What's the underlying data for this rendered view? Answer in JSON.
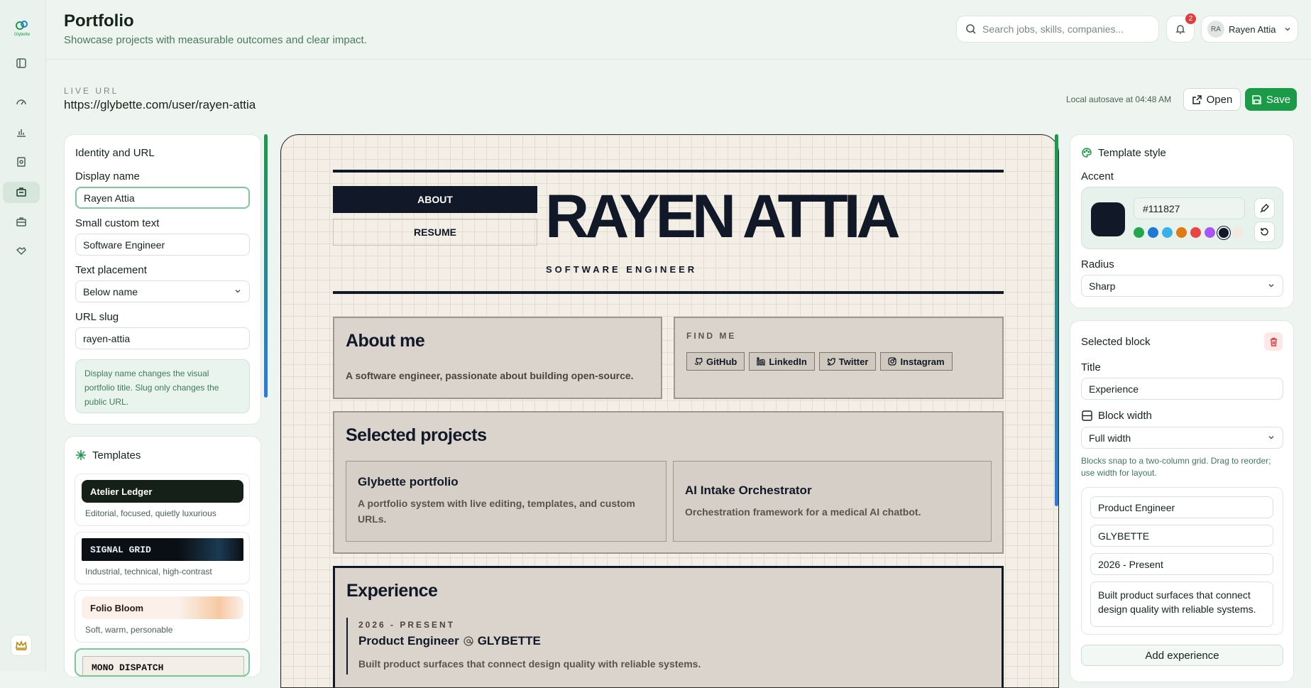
{
  "header": {
    "title": "Portfolio",
    "subtitle": "Showcase projects with measurable outcomes and clear impact.",
    "search_placeholder": "Search jobs, skills, companies...",
    "notification_count": "2",
    "user_initials": "RA",
    "user_name": "Rayen Attia"
  },
  "rail": {
    "logo_text": "Glybette",
    "icons": [
      "sidebar-toggle-icon",
      "speedometer-icon",
      "bar-chart-icon",
      "document-icon",
      "portfolio-icon",
      "briefcase-icon",
      "handshake-icon",
      "crown-icon"
    ]
  },
  "toolbar": {
    "live_url_label": "LIVE URL",
    "live_url": "https://glybette.com/user/rayen-attia",
    "autosave": "Local autosave at 04:48 AM",
    "open_label": "Open",
    "save_label": "Save"
  },
  "identity": {
    "heading": "Identity and URL",
    "display_name_label": "Display name",
    "display_name_value": "Rayen Attia",
    "custom_text_label": "Small custom text",
    "custom_text_value": "Software Engineer",
    "placement_label": "Text placement",
    "placement_value": "Below name",
    "slug_label": "URL slug",
    "slug_value": "rayen-attia",
    "note": "Display name changes the visual portfolio title. Slug only changes the public URL."
  },
  "templates": {
    "heading": "Templates",
    "items": [
      {
        "name": "Atelier Ledger",
        "desc": "Editorial, focused, quietly luxurious"
      },
      {
        "name": "SIGNAL GRID",
        "desc": "Industrial, technical, high-contrast"
      },
      {
        "name": "Folio Bloom",
        "desc": "Soft, warm, personable"
      },
      {
        "name": "MONO DISPATCH",
        "desc": ""
      }
    ]
  },
  "preview": {
    "nav_about": "ABOUT",
    "nav_resume": "RESUME",
    "name": "RAYEN ATTIA",
    "tagline": "SOFTWARE ENGINEER",
    "about_title": "About me",
    "about_text": "A software engineer, passionate about building open-source.",
    "find_me_label": "FIND ME",
    "socials": [
      "GitHub",
      "LinkedIn",
      "Twitter",
      "Instagram"
    ],
    "projects_title": "Selected projects",
    "projects": [
      {
        "title": "Glybette portfolio",
        "desc": "A portfolio system with live editing, templates, and custom URLs."
      },
      {
        "title": "AI Intake Orchestrator",
        "desc": "Orchestration framework for a medical AI chatbot."
      }
    ],
    "experience_title": "Experience",
    "experience_date": "2026 - PRESENT",
    "experience_role": "Product Engineer",
    "experience_company": "GLYBETTE",
    "experience_desc": "Built product surfaces that connect design quality with reliable systems."
  },
  "style": {
    "heading": "Template style",
    "accent_label": "Accent",
    "accent_hex": "#111827",
    "swatches": [
      "#22a84a",
      "#1e7ad6",
      "#3ab0e8",
      "#e07a12",
      "#e84545",
      "#a855f7",
      "#111827",
      "#f5e9df"
    ],
    "radius_label": "Radius",
    "radius_value": "Sharp"
  },
  "block": {
    "heading": "Selected block",
    "title_label": "Title",
    "title_value": "Experience",
    "width_label": "Block width",
    "width_value": "Full width",
    "hint": "Blocks snap to a two-column grid. Drag to reorder; use width for layout.",
    "exp_role": "Product Engineer",
    "exp_company": "GLYBETTE",
    "exp_dates": "2026 - Present",
    "exp_desc": "Built product surfaces that connect design quality with reliable systems.",
    "add_label": "Add experience"
  }
}
